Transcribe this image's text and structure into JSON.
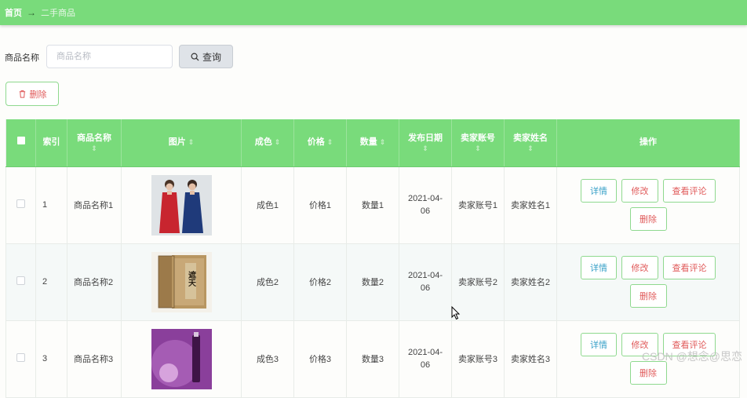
{
  "breadcrumb": {
    "home": "首页",
    "separator": "→",
    "current": "二手商品"
  },
  "search": {
    "label": "商品名称",
    "placeholder": "商品名称",
    "value": "",
    "query_label": "查询",
    "query_icon": "search-icon"
  },
  "toolbar": {
    "delete_label": "删除",
    "delete_icon": "trash-icon"
  },
  "table": {
    "headers": {
      "index": "索引",
      "name": "商品名称",
      "image": "图片",
      "condition": "成色",
      "price": "价格",
      "quantity": "数量",
      "date": "发布日期",
      "seller_account": "卖家账号",
      "seller_name": "卖家姓名",
      "actions": "操作"
    },
    "sort_glyph": "⇕",
    "rows": [
      {
        "index": "1",
        "name": "商品名称1",
        "image": "red-and-navy-dresses-photo",
        "condition": "成色1",
        "price": "价格1",
        "quantity": "数量1",
        "date": "2021-04-06",
        "seller_account": "卖家账号1",
        "seller_name": "卖家姓名1"
      },
      {
        "index": "2",
        "name": "商品名称2",
        "image": "book-box-set-photo",
        "book_title": "遮天",
        "condition": "成色2",
        "price": "价格2",
        "quantity": "数量2",
        "date": "2021-04-06",
        "seller_account": "卖家账号2",
        "seller_name": "卖家姓名2"
      },
      {
        "index": "3",
        "name": "商品名称3",
        "image": "purple-cosmetics-photo",
        "condition": "成色3",
        "price": "价格3",
        "quantity": "数量3",
        "date": "2021-04-06",
        "seller_account": "卖家账号3",
        "seller_name": "卖家姓名3"
      }
    ],
    "actions": {
      "detail": "详情",
      "edit": "修改",
      "review": "查看评论",
      "remove": "删除"
    }
  },
  "watermark": "CSDN @想念@思恋",
  "colors": {
    "header_green": "#79db7b",
    "border_green": "#8fd98f",
    "danger": "#e05a5a",
    "info": "#3aa1c8"
  }
}
